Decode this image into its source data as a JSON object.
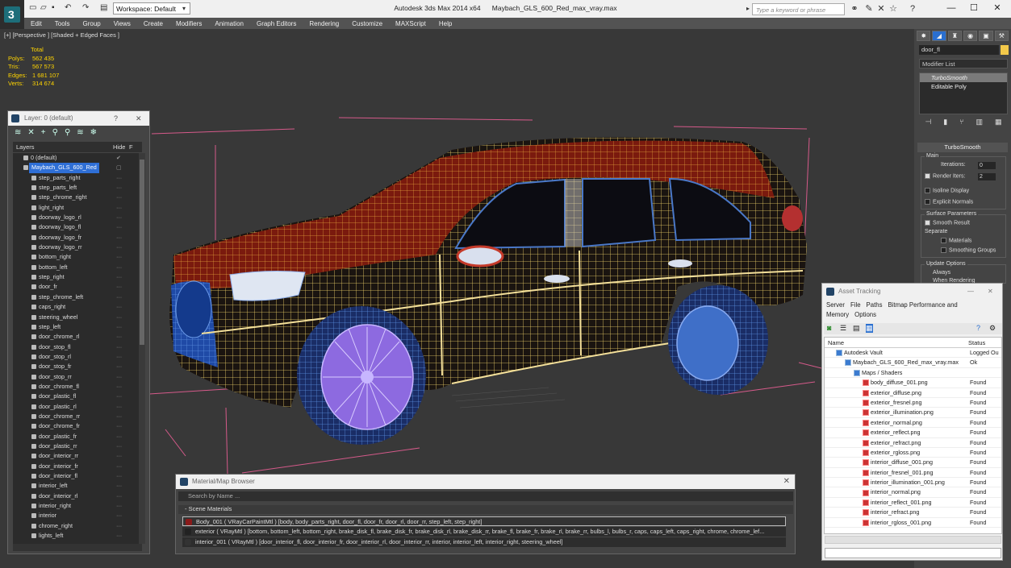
{
  "window": {
    "title": "Autodesk 3ds Max  2014 x64",
    "file": "Maybach_GLS_600_Red_max_vray.max",
    "workspace": "Workspace: Default",
    "search_placeholder": "Type a keyword or phrase"
  },
  "menu": [
    "Edit",
    "Tools",
    "Group",
    "Views",
    "Create",
    "Modifiers",
    "Animation",
    "Graph Editors",
    "Rendering",
    "Customize",
    "MAXScript",
    "Help"
  ],
  "viewport": {
    "label": "[+] [Perspective ] [Shaded + Edged Faces ]",
    "stats": {
      "header": "Total",
      "rows": [
        {
          "k": "Polys:",
          "v": "562 435"
        },
        {
          "k": "Tris:",
          "v": "567 573"
        },
        {
          "k": "Edges:",
          "v": "1 681 107"
        },
        {
          "k": "Verts:",
          "v": "314 674"
        }
      ]
    }
  },
  "command_panel": {
    "object_name": "door_fl",
    "object_color": "#f3c94a",
    "modifier_list": "Modifier List",
    "stack": [
      "TurboSmooth",
      "Editable Poly"
    ],
    "rollout": "TurboSmooth",
    "main": "Main",
    "iterations_label": "Iterations:",
    "iterations": "0",
    "render_iters_label": "Render Iters:",
    "render_iters": "2",
    "isoline": "Isoline Display",
    "explicit": "Explicit Normals",
    "surface": "Surface Parameters",
    "smooth_result": "Smooth Result",
    "separate": "Separate",
    "materials": "Materials",
    "smoothing_groups": "Smoothing Groups",
    "update_options": "Update Options",
    "always": "Always",
    "when_rendering": "When Rendering"
  },
  "layer_panel": {
    "title": "Layer: 0 (default)",
    "help": "?",
    "close": "✕",
    "col_layers": "Layers",
    "col_hide": "Hide",
    "col_f": "F",
    "top": [
      "0 (default)",
      "Maybach_GLS_600_Red"
    ],
    "items": [
      "step_parts_right",
      "step_parts_left",
      "step_chrome_right",
      "light_right",
      "doorway_logo_rl",
      "doorway_logo_fl",
      "doorway_logo_fr",
      "doorway_logo_rr",
      "bottom_right",
      "bottom_left",
      "step_right",
      "door_fr",
      "step_chrome_left",
      "caps_right",
      "steering_wheel",
      "step_left",
      "door_chrome_rl",
      "door_stop_fl",
      "door_stop_rl",
      "door_stop_fr",
      "door_stop_rr",
      "door_chrome_fl",
      "door_plastic_fl",
      "door_plastic_rl",
      "door_chrome_rr",
      "door_chrome_fr",
      "door_plastic_fr",
      "door_plastic_rr",
      "door_interior_rr",
      "door_interior_fr",
      "door_interior_fl",
      "interior_left",
      "door_interior_rl",
      "interior_right",
      "interior",
      "chrome_right",
      "lights_left"
    ]
  },
  "material_browser": {
    "title": "Material/Map Browser",
    "search": "Search by Name ...",
    "category": "- Scene Materials",
    "close": "✕",
    "rows": [
      {
        "text": "Body_001 ( VRayCarPaintMtl ) [body, body_parts_right, door_fl, door_fr, door_rl, door_rr, step_left, step_right]",
        "color": "#8a1a1a"
      },
      {
        "text": "exterior ( VRayMtl ) [bottom, bottom_left, bottom_right, brake_disk_fl, brake_disk_fr, brake_disk_rl, brake_disk_rr, brake_fl, brake_fr, brake_rl, brake_rr, bulbs_l, bulbs_r, caps, caps_left, caps_right, chrome, chrome_lef...",
        "color": "#222"
      },
      {
        "text": "interior_001 ( VRayMtl ) [door_interior_fl, door_interior_fr, door_interior_rl, door_interior_rr, interior, interior_left, interior_right, steering_wheel]",
        "color": "#333"
      }
    ]
  },
  "asset_tracking": {
    "title": "Asset Tracking",
    "menu": [
      "Server",
      "File",
      "Paths",
      "Bitmap Performance and Memory",
      "Options"
    ],
    "col_name": "Name",
    "col_status": "Status",
    "rows": [
      {
        "name": "Autodesk Vault",
        "status": "Logged Ou",
        "indent": 0
      },
      {
        "name": "Maybach_GLS_600_Red_max_vray.max",
        "status": "Ok",
        "indent": 1
      },
      {
        "name": "Maps / Shaders",
        "status": "",
        "indent": 2
      },
      {
        "name": "body_diffuse_001.png",
        "status": "Found",
        "indent": 3
      },
      {
        "name": "exterior_diffuse.png",
        "status": "Found",
        "indent": 3
      },
      {
        "name": "exterior_fresnel.png",
        "status": "Found",
        "indent": 3
      },
      {
        "name": "exterior_illumination.png",
        "status": "Found",
        "indent": 3
      },
      {
        "name": "exterior_normal.png",
        "status": "Found",
        "indent": 3
      },
      {
        "name": "exterior_reflect.png",
        "status": "Found",
        "indent": 3
      },
      {
        "name": "exterior_refract.png",
        "status": "Found",
        "indent": 3
      },
      {
        "name": "exterior_rgloss.png",
        "status": "Found",
        "indent": 3
      },
      {
        "name": "interior_diffuse_001.png",
        "status": "Found",
        "indent": 3
      },
      {
        "name": "interior_fresnel_001.png",
        "status": "Found",
        "indent": 3
      },
      {
        "name": "interior_illumination_001.png",
        "status": "Found",
        "indent": 3
      },
      {
        "name": "interior_normal.png",
        "status": "Found",
        "indent": 3
      },
      {
        "name": "interior_reflect_001.png",
        "status": "Found",
        "indent": 3
      },
      {
        "name": "interior_refract.png",
        "status": "Found",
        "indent": 3
      },
      {
        "name": "interior_rgloss_001.png",
        "status": "Found",
        "indent": 3
      }
    ]
  }
}
